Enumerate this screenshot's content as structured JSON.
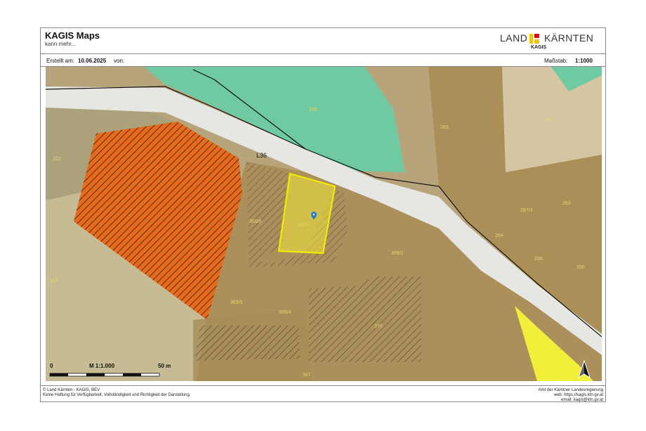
{
  "header": {
    "app_title": "KAGIS Maps",
    "app_subtitle": "kann mehr...",
    "logo": {
      "left": "LAND",
      "right": "KÄRNTEN",
      "sub": "KAGIS",
      "colors": [
        "#f4c400",
        "#e2001a"
      ]
    }
  },
  "meta": {
    "created_label": "Erstellt am:",
    "created_value": "10.06.2025",
    "by_label": "von:",
    "scale_label": "Maßstab:",
    "scale_value": "1:1000"
  },
  "map": {
    "road_label": "L36",
    "parcels": [
      "295",
      "283",
      "288",
      "322",
      "369/6",
      "369/7",
      "287/3",
      "283",
      "284",
      "286",
      "150",
      "369/1",
      "362",
      "369/5",
      "369/4",
      "370",
      "387"
    ],
    "colors": {
      "orange": "#e86a1c",
      "green": "#6fc9a1",
      "yellow": "#f2ef3a",
      "selected": "#f2e63a",
      "brown": "#a88a52",
      "road": "#e6e6e2"
    }
  },
  "scalebar": {
    "start": "0",
    "label": "M 1:1.000",
    "end": "50 m"
  },
  "footer": {
    "left_line1": "© Land Kärnten - KAGIS, BEV",
    "left_line2": "Keine Haftung für Verfügbarkeit, Vollständigkeit und Richtigkeit der Darstellung.",
    "right_line1": "Amt der Kärntner Landesregierung",
    "right_line2": "web: https://kagis.ktn.gv.at",
    "right_line3": "email: kagis@ktn.gv.at"
  }
}
